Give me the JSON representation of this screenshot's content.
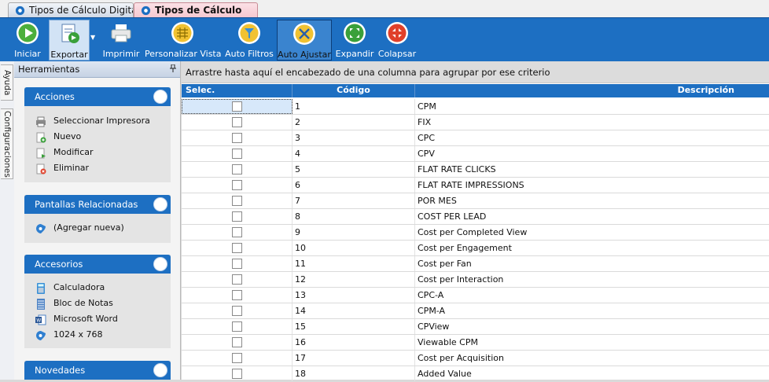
{
  "tabs": [
    {
      "label": "Tipos de Cálculo Digital",
      "active": false
    },
    {
      "label": "Tipos de Cálculo Digital",
      "active": true
    }
  ],
  "toolbar": {
    "buttons": [
      {
        "label": "Iniciar",
        "icon": "play-icon"
      },
      {
        "label": "Exportar",
        "icon": "export-icon"
      },
      {
        "label": "Imprimir",
        "icon": "printer-icon"
      },
      {
        "label": "Personalizar Vista",
        "icon": "grid-icon"
      },
      {
        "label": "Auto Filtros",
        "icon": "filter-icon"
      },
      {
        "label": "Auto Ajustar",
        "icon": "wrench-icon"
      },
      {
        "label": "Expandir",
        "icon": "expand-icon"
      },
      {
        "label": "Colapsar",
        "icon": "collapse-icon"
      }
    ],
    "split_arrow": "▼"
  },
  "side_tabs": {
    "help": "Ayuda",
    "settings": "Configuraciones"
  },
  "tools": {
    "title": "Herramientas",
    "groups": [
      {
        "title": "Acciones",
        "items": [
          {
            "label": "Seleccionar Impresora",
            "icon": "printer-icon"
          },
          {
            "label": "Nuevo",
            "icon": "new-icon"
          },
          {
            "label": "Modificar",
            "icon": "edit-icon"
          },
          {
            "label": "Eliminar",
            "icon": "delete-icon"
          }
        ]
      },
      {
        "title": "Pantallas Relacionadas",
        "items": [
          {
            "label": "(Agregar nueva)",
            "icon": "app-logo-icon"
          }
        ]
      },
      {
        "title": "Accesorios",
        "items": [
          {
            "label": "Calculadora",
            "icon": "calculator-icon"
          },
          {
            "label": "Bloc de Notas",
            "icon": "notepad-icon"
          },
          {
            "label": "Microsoft Word",
            "icon": "word-icon"
          },
          {
            "label": "1024 x 768",
            "icon": "app-logo-icon"
          }
        ]
      },
      {
        "title": "Novedades",
        "items": []
      }
    ]
  },
  "grid": {
    "group_by_hint": "Arrastre hasta aquí el encabezado de una columna para agrupar por ese criterio",
    "columns": [
      "Selec.",
      "Código",
      "Descripción"
    ],
    "rows": [
      {
        "codigo": "1",
        "descripcion": "CPM"
      },
      {
        "codigo": "2",
        "descripcion": "FIX"
      },
      {
        "codigo": "3",
        "descripcion": "CPC"
      },
      {
        "codigo": "4",
        "descripcion": "CPV"
      },
      {
        "codigo": "5",
        "descripcion": "FLAT RATE CLICKS"
      },
      {
        "codigo": "6",
        "descripcion": "FLAT RATE IMPRESSIONS"
      },
      {
        "codigo": "7",
        "descripcion": "POR MES"
      },
      {
        "codigo": "8",
        "descripcion": "COST PER LEAD"
      },
      {
        "codigo": "9",
        "descripcion": "Cost per Completed View"
      },
      {
        "codigo": "10",
        "descripcion": "Cost per Engagement"
      },
      {
        "codigo": "11",
        "descripcion": "Cost per Fan"
      },
      {
        "codigo": "12",
        "descripcion": "Cost per Interaction"
      },
      {
        "codigo": "13",
        "descripcion": "CPC-A"
      },
      {
        "codigo": "14",
        "descripcion": "CPM-A"
      },
      {
        "codigo": "15",
        "descripcion": "CPView"
      },
      {
        "codigo": "16",
        "descripcion": "Viewable CPM"
      },
      {
        "codigo": "17",
        "descripcion": "Cost per Acquisition"
      },
      {
        "codigo": "18",
        "descripcion": "Added Value"
      }
    ]
  },
  "colors": {
    "accent": "#1d6fc2",
    "active_tab": "#f6c8d0"
  }
}
